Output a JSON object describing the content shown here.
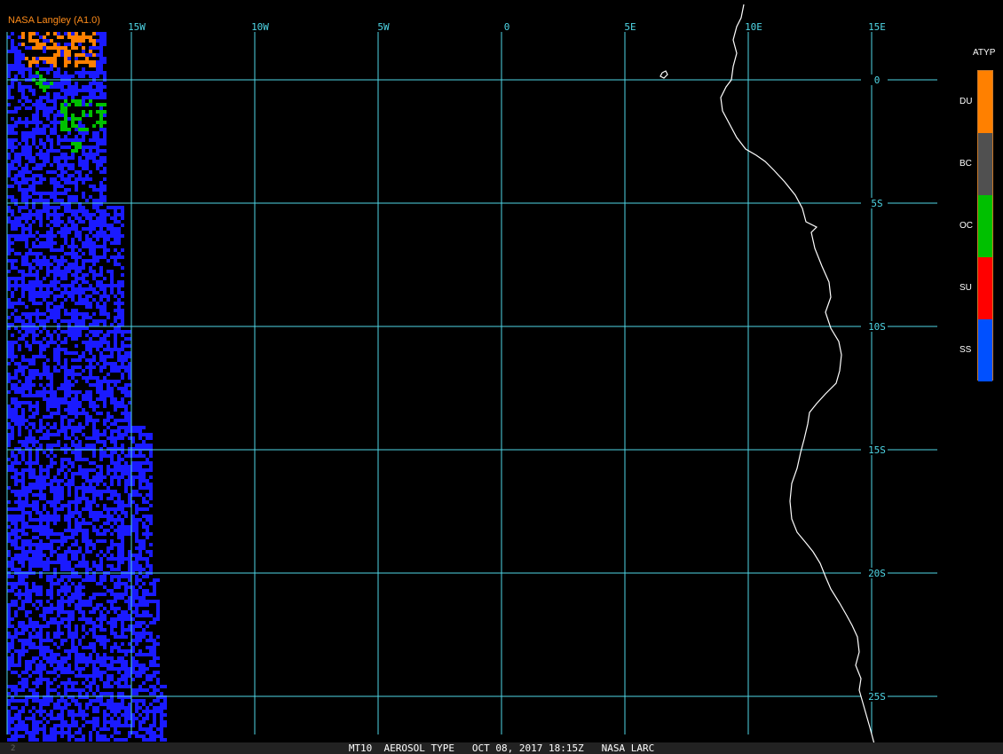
{
  "map": {
    "source_label": "NASA Langley (A1.0)",
    "lon_labels": [
      "15W",
      "10W",
      "5W",
      "0",
      "5E",
      "10E",
      "15E"
    ],
    "lat_labels": [
      "0",
      "5S",
      "10S",
      "15S",
      "20S",
      "25S"
    ],
    "grid_color": "#4fd6e6",
    "coast_color": "#ffffff",
    "background": "#000000"
  },
  "legend": {
    "title": "ATYP",
    "items": [
      {
        "label": "DU",
        "color": "#ff8000"
      },
      {
        "label": "BC",
        "color": "#505050"
      },
      {
        "label": "OC",
        "color": "#00c000"
      },
      {
        "label": "SU",
        "color": "#ff0000"
      },
      {
        "label": "SS",
        "color": "#0050ff"
      }
    ]
  },
  "footer": {
    "caption": "MT10  AEROSOL TYPE   OCT 08, 2017 18:15Z   NASA LARC",
    "frame_number": "2"
  }
}
